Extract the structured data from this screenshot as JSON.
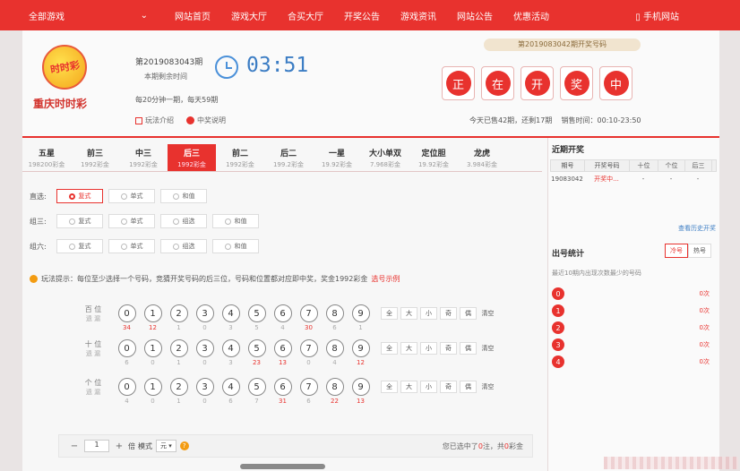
{
  "topbar": {
    "all_games": "全部游戏",
    "nav": [
      "网站首页",
      "游戏大厅",
      "合买大厅",
      "开奖公告",
      "游戏资讯",
      "网站公告",
      "优惠活动"
    ],
    "mobile": "手机网站"
  },
  "lottery": {
    "logo_text": "时时彩",
    "name": "重庆时时彩",
    "issue": "第2019083043期",
    "remain_label": "本期剩余时间",
    "timer": "03:51",
    "frequency": "每20分钟一期，每天59期",
    "link_play": "玩法介绍",
    "link_prize": "中奖说明"
  },
  "draw": {
    "title": "第2019083042期开奖号码",
    "chars": [
      "正",
      "在",
      "开",
      "奖",
      "中"
    ],
    "sold": "今天已售42期，还剩17期",
    "hours": "销售时间：00:10-23:50"
  },
  "tabs": [
    {
      "name": "五星",
      "prize": "198200彩金"
    },
    {
      "name": "前三",
      "prize": "1992彩金"
    },
    {
      "name": "中三",
      "prize": "1992彩金"
    },
    {
      "name": "后三",
      "prize": "1992彩金"
    },
    {
      "name": "前二",
      "prize": "1992彩金"
    },
    {
      "name": "后二",
      "prize": "199.2彩金"
    },
    {
      "name": "一星",
      "prize": "19.92彩金"
    },
    {
      "name": "大小单双",
      "prize": "7.968彩金"
    },
    {
      "name": "定位胆",
      "prize": "19.92彩金"
    },
    {
      "name": "龙虎",
      "prize": "3.984彩金"
    }
  ],
  "play_rows": [
    {
      "label": "直选:",
      "options": [
        "复式",
        "单式",
        "和值"
      ]
    },
    {
      "label": "组三:",
      "options": [
        "复式",
        "单式",
        "组选",
        "和值"
      ]
    },
    {
      "label": "组六:",
      "options": [
        "复式",
        "单式",
        "组选",
        "和值"
      ]
    }
  ],
  "hint": {
    "text": "玩法提示：每位至少选择一个号码，竞猜开奖号码的后三位，号码和位置都对应即中奖，奖金1992彩金",
    "example": "选号示例"
  },
  "digit_rows": [
    {
      "label": "百 位",
      "sub": "遗 漏",
      "omissions": [
        "34",
        "12",
        "1",
        "0",
        "3",
        "5",
        "4",
        "30",
        "6",
        "1"
      ]
    },
    {
      "label": "十 位",
      "sub": "遗 漏",
      "omissions": [
        "6",
        "0",
        "1",
        "0",
        "3",
        "23",
        "13",
        "0",
        "4",
        "12"
      ]
    },
    {
      "label": "个 位",
      "sub": "遗 漏",
      "omissions": [
        "4",
        "0",
        "1",
        "0",
        "6",
        "7",
        "31",
        "6",
        "22",
        "13"
      ]
    }
  ],
  "digits": [
    "0",
    "1",
    "2",
    "3",
    "4",
    "5",
    "6",
    "7",
    "8",
    "9"
  ],
  "hot_omission_threshold": 10,
  "quick": [
    "全",
    "大",
    "小",
    "奇",
    "偶",
    "清空"
  ],
  "bottom": {
    "minus": "−",
    "multiple": "1",
    "plus": "+",
    "multiple_label": "倍",
    "mode_label": "模式",
    "mode_value": "元 ▾",
    "help": "?",
    "summary_prefix": "您已选中了",
    "count": "0",
    "summary_mid": "注，共",
    "amount": "0",
    "summary_suffix": "彩金"
  },
  "recent": {
    "title": "近期开奖",
    "headers": [
      "期号",
      "开奖号码",
      "十位",
      "个位",
      "后三"
    ],
    "rows": [
      {
        "issue": "19083042",
        "number": "开奖中...",
        "ten": "-",
        "one": "-",
        "last3": "-"
      }
    ],
    "history_link": "查看历史开奖"
  },
  "stats": {
    "title": "出号统计",
    "tab_cold": "冷号",
    "tab_hot": "热号",
    "desc": "最近10期内出现次数最少的号码",
    "rows": [
      {
        "ball": "0",
        "count": "0次"
      },
      {
        "ball": "1",
        "count": "0次"
      },
      {
        "ball": "2",
        "count": "0次"
      },
      {
        "ball": "3",
        "count": "0次"
      },
      {
        "ball": "4",
        "count": "0次"
      }
    ]
  },
  "colors": {
    "primary": "#e8322e",
    "timer": "#3c7dc4",
    "hint": "#f39c12"
  }
}
